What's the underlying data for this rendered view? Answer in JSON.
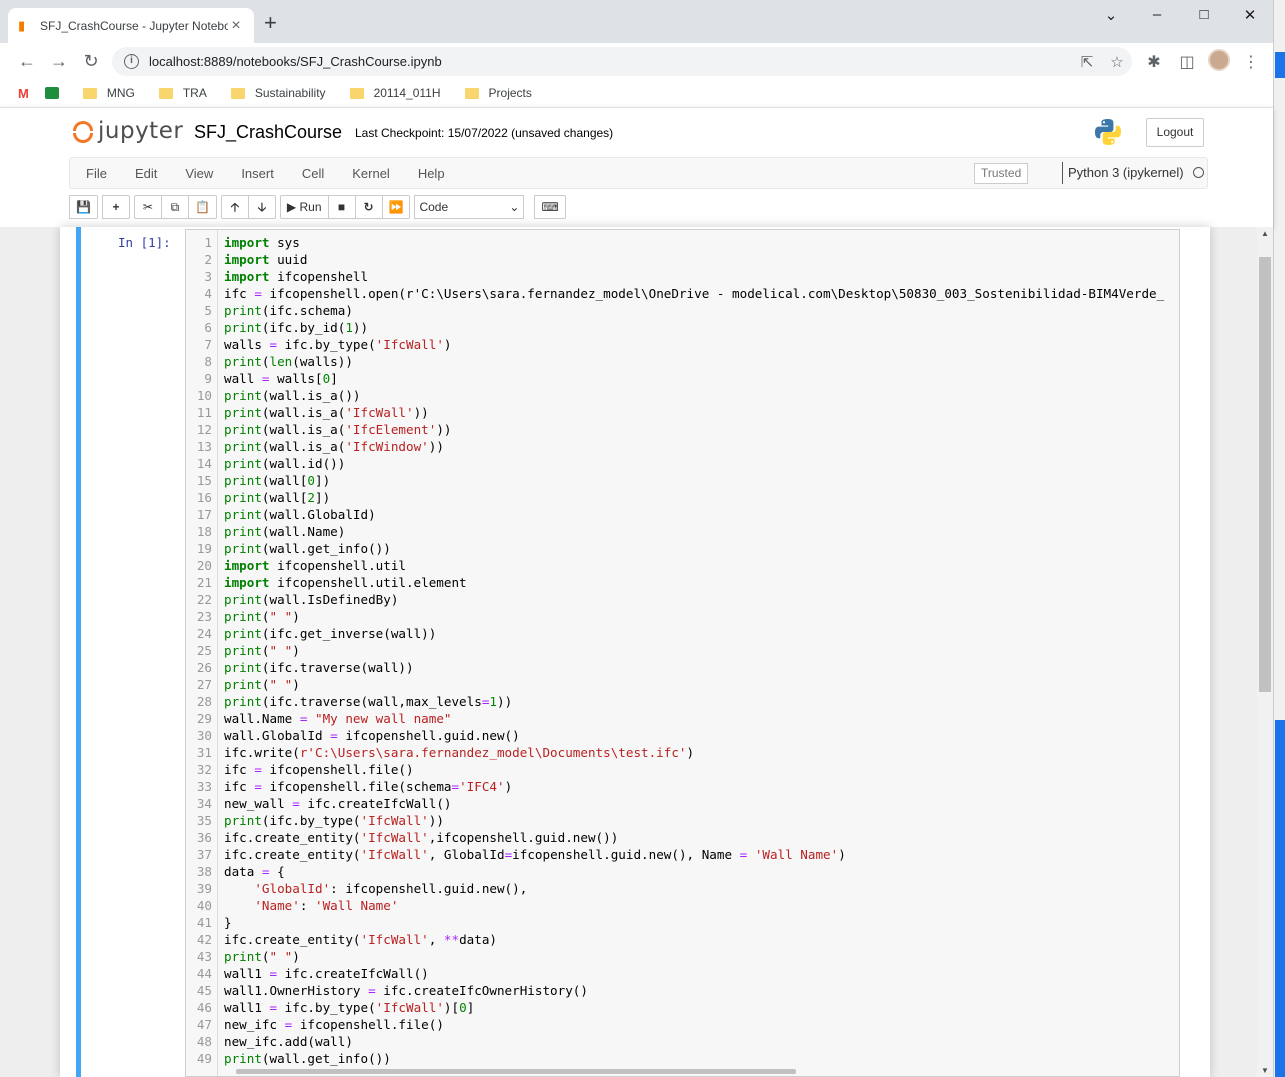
{
  "browser": {
    "tab_title": "SFJ_CrashCourse - Jupyter Notebook",
    "url": "localhost:8889/notebooks/SFJ_CrashCourse.ipynb",
    "bookmarks": [
      "MNG",
      "TRA",
      "Sustainability",
      "20114_011H",
      "Projects"
    ],
    "gmail_glyph": "M"
  },
  "jupyter": {
    "logo_text": "jupyter",
    "notebook_name": "SFJ_CrashCourse",
    "checkpoint": "Last Checkpoint: 15/07/2022  (unsaved changes)",
    "logout_label": "Logout",
    "menu": [
      "File",
      "Edit",
      "View",
      "Insert",
      "Cell",
      "Kernel",
      "Help"
    ],
    "trusted_label": "Trusted",
    "kernel_name": "Python 3 (ipykernel)",
    "run_label": "Run",
    "cell_type": "Code"
  },
  "cell": {
    "prompt": "In [1]:",
    "lines": [
      "import sys",
      "import uuid",
      "import ifcopenshell",
      "ifc = ifcopenshell.open(r'C:\\Users\\sara.fernandez_model\\OneDrive - modelical.com\\Desktop\\50830_003_Sostenibilidad-BIM4Verde_",
      "print(ifc.schema)",
      "print(ifc.by_id(1))",
      "walls = ifc.by_type('IfcWall')",
      "print(len(walls))",
      "wall = walls[0]",
      "print(wall.is_a())",
      "print(wall.is_a('IfcWall'))",
      "print(wall.is_a('IfcElement'))",
      "print(wall.is_a('IfcWindow'))",
      "print(wall.id())",
      "print(wall[0])",
      "print(wall[2])",
      "print(wall.GlobalId)",
      "print(wall.Name)",
      "print(wall.get_info())",
      "import ifcopenshell.util",
      "import ifcopenshell.util.element",
      "print(wall.IsDefinedBy)",
      "print(\" \")",
      "print(ifc.get_inverse(wall))",
      "print(\" \")",
      "print(ifc.traverse(wall))",
      "print(\" \")",
      "print(ifc.traverse(wall,max_levels=1))",
      "wall.Name = \"My new wall name\"",
      "wall.GlobalId = ifcopenshell.guid.new()",
      "ifc.write(r'C:\\Users\\sara.fernandez_model\\Documents\\test.ifc')",
      "ifc = ifcopenshell.file()",
      "ifc = ifcopenshell.file(schema='IFC4')",
      "new_wall = ifc.createIfcWall()",
      "print(ifc.by_type('IfcWall'))",
      "ifc.create_entity('IfcWall',ifcopenshell.guid.new())",
      "ifc.create_entity('IfcWall', GlobalId=ifcopenshell.guid.new(), Name = 'Wall Name')",
      "data = {",
      "    'GlobalId': ifcopenshell.guid.new(),",
      "    'Name': 'Wall Name'",
      "}",
      "ifc.create_entity('IfcWall', **data)",
      "print(\" \")",
      "wall1 = ifc.createIfcWall()",
      "wall1.OwnerHistory = ifc.createIfcOwnerHistory()",
      "wall1 = ifc.by_type('IfcWall')[0]",
      "new_ifc = ifcopenshell.file()",
      "new_ifc.add(wall)",
      "print(wall.get_info())"
    ]
  },
  "colors": {
    "accent_cell_border": "#42a5f5",
    "jupyter_orange": "#f37726",
    "keyword": "#008000",
    "string": "#ba2121"
  }
}
